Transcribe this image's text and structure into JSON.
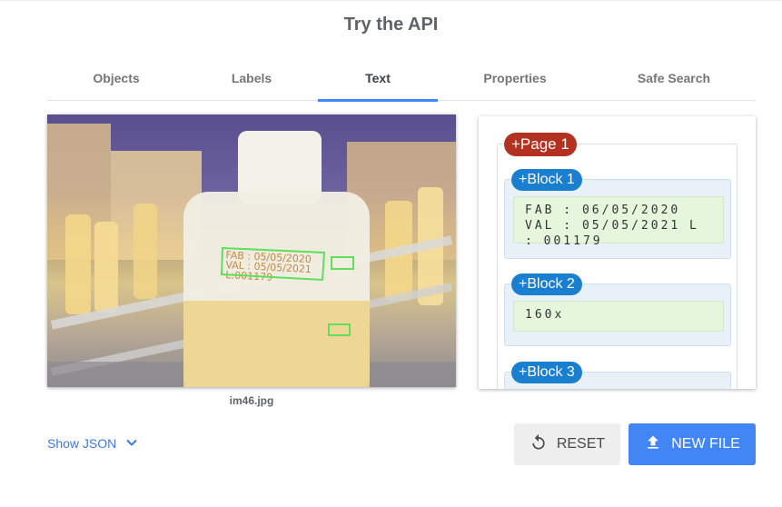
{
  "header": {
    "title": "Try the API"
  },
  "tabs": [
    {
      "label": "Objects"
    },
    {
      "label": "Labels"
    },
    {
      "label": "Text"
    },
    {
      "label": "Properties"
    },
    {
      "label": "Safe Search"
    }
  ],
  "active_tab": "Text",
  "image": {
    "caption": "im46.jpg",
    "detected_overlay_text": [
      "FAB : 05/05/2020",
      "VAL : 05/05/2021",
      "L:001179"
    ]
  },
  "results": {
    "page_label": "+Page 1",
    "blocks": [
      {
        "label": "+Block 1",
        "text": "FAB : 06/05/2020 VAL : 05/05/2021 L : 001179"
      },
      {
        "label": "+Block 2",
        "text": "160x"
      },
      {
        "label": "+Block 3",
        "text": ""
      }
    ]
  },
  "footer": {
    "show_json_label": "Show JSON",
    "reset_label": "RESET",
    "new_file_label": "NEW FILE"
  },
  "colors": {
    "accent": "#4285f4",
    "page_pill": "#b23121",
    "block_pill": "#1b7fd0",
    "detection_box": "#5ee05a"
  }
}
